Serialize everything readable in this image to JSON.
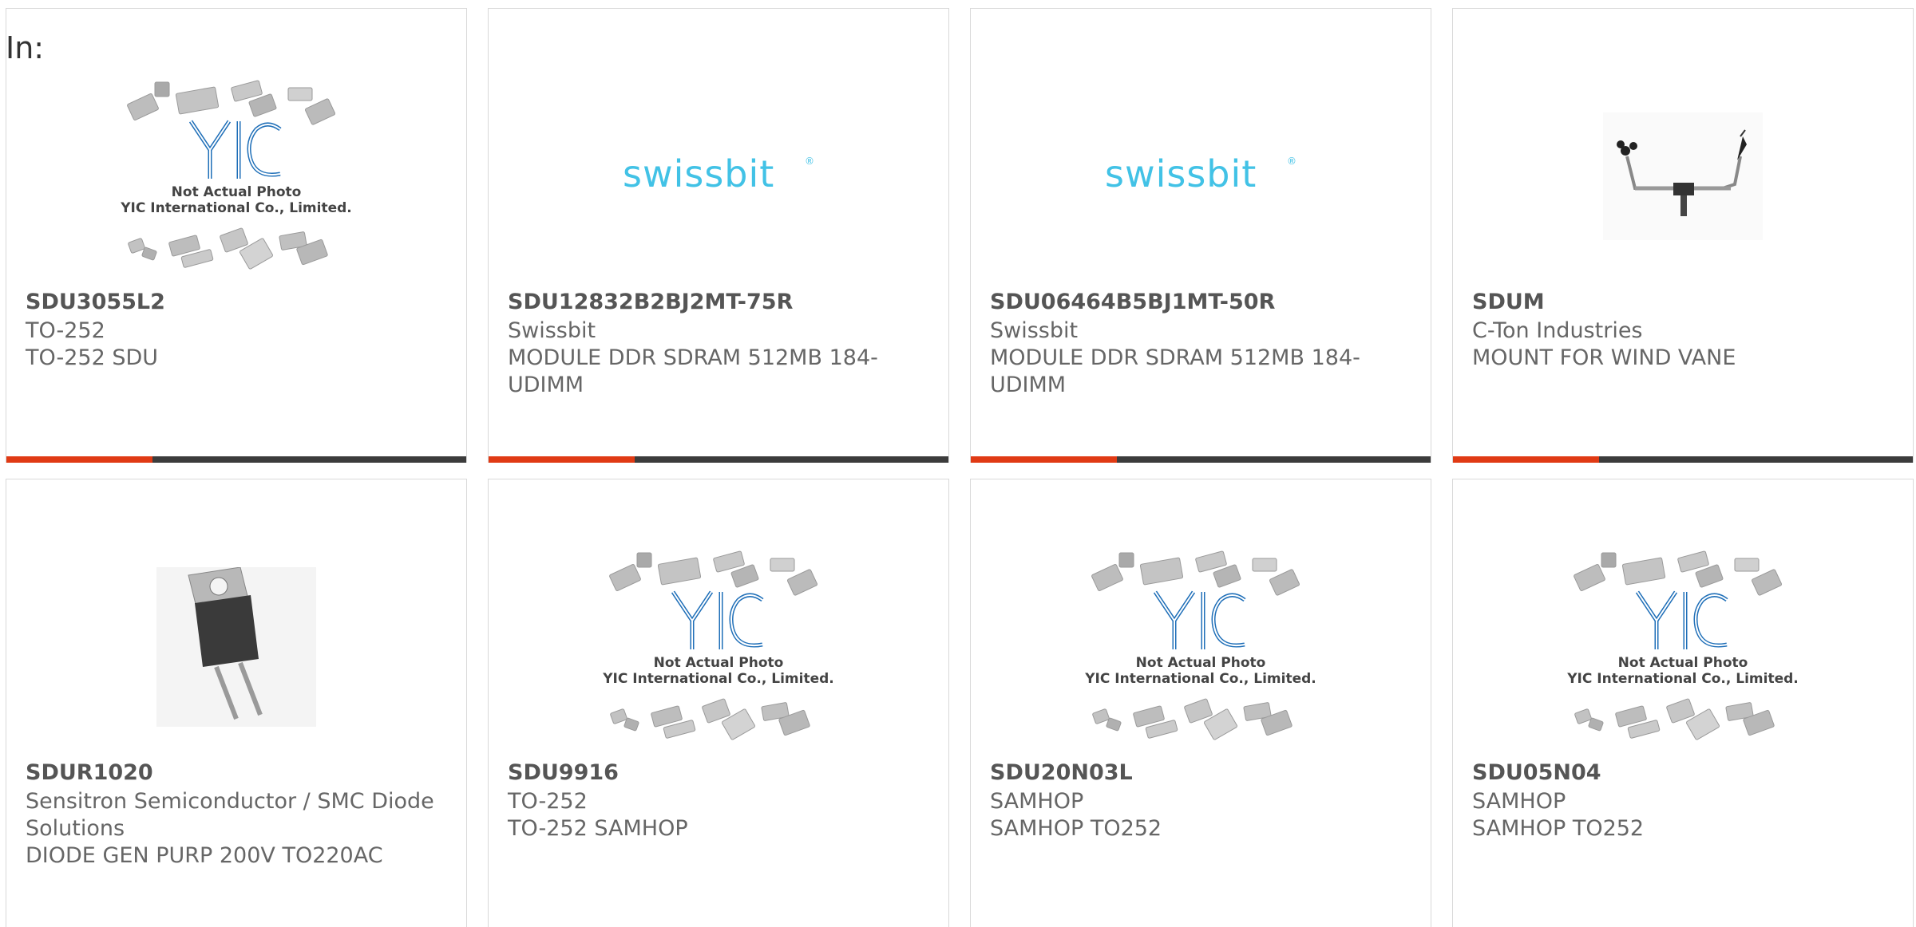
{
  "header": {
    "in_label": "In:"
  },
  "placeholder_photo": {
    "logo_text": "YIC",
    "line1": "Not Actual Photo",
    "line2": "YIC International Co., Limited."
  },
  "swissbit_logo": {
    "text": "swissbit",
    "mark": "®"
  },
  "cards": [
    {
      "title": "SDU3055L2",
      "lines": [
        "TO-252",
        "TO-252 SDU"
      ],
      "image": "yic-placeholder"
    },
    {
      "title": "SDU12832B2BJ2MT-75R",
      "lines": [
        "Swissbit",
        "MODULE DDR SDRAM 512MB 184-UDIMM"
      ],
      "image": "swissbit-logo"
    },
    {
      "title": "SDU06464B5BJ1MT-50R",
      "lines": [
        "Swissbit",
        "MODULE DDR SDRAM 512MB 184-UDIMM"
      ],
      "image": "swissbit-logo"
    },
    {
      "title": "SDUM",
      "lines": [
        "C-Ton Industries",
        "MOUNT FOR WIND VANE"
      ],
      "image": "wind-vane-mount"
    },
    {
      "title": "SDUR1020",
      "lines": [
        "Sensitron Semiconductor / SMC Diode Solutions",
        "DIODE GEN PURP 200V TO220AC"
      ],
      "image": "to220-diode"
    },
    {
      "title": "SDU9916",
      "lines": [
        "TO-252",
        "TO-252 SAMHOP"
      ],
      "image": "yic-placeholder"
    },
    {
      "title": "SDU20N03L",
      "lines": [
        "SAMHOP",
        "SAMHOP TO252"
      ],
      "image": "yic-placeholder"
    },
    {
      "title": "SDU05N04",
      "lines": [
        "SAMHOP",
        "SAMHOP TO252"
      ],
      "image": "yic-placeholder"
    }
  ],
  "colors": {
    "accent": "#e03a14",
    "bar": "#3c3c3c",
    "swissbit": "#42c2e6",
    "yic_blue": "#1f6fb8"
  }
}
